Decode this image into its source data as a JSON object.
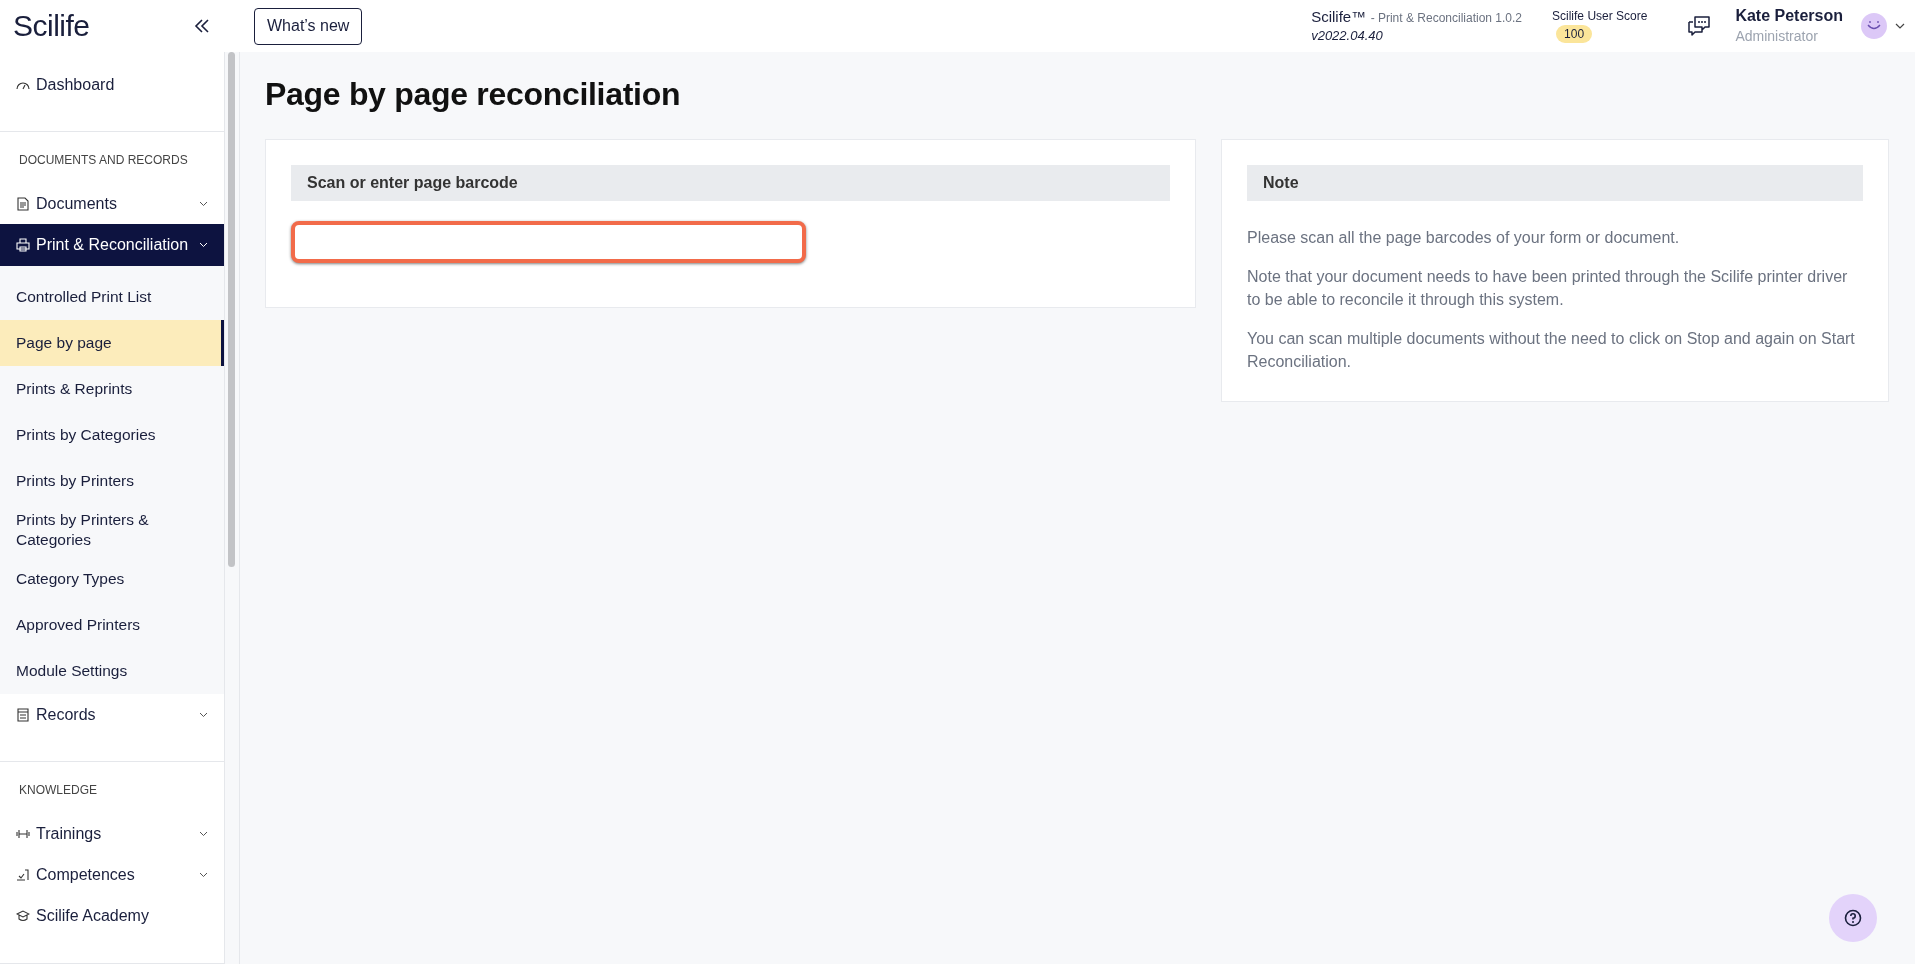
{
  "header": {
    "logo": "Scilife",
    "whats_new": "What’s new",
    "app_name": "Scilife™",
    "app_module": "- Print & Reconciliation 1.0.2",
    "app_version": "v2022.04.40",
    "score_label": "Scilife User Score",
    "score": "100",
    "user_name": "Kate Peterson",
    "user_role": "Administrator"
  },
  "sidebar": {
    "items": [
      {
        "kind": "link",
        "label": "Dashboard",
        "selected": false
      },
      {
        "kind": "section",
        "label": "DOCUMENTS AND RECORDS"
      },
      {
        "kind": "group",
        "label": "Documents",
        "selected": false
      },
      {
        "kind": "group",
        "label": "Print & Reconciliation",
        "selected": true,
        "expanded": true,
        "children": [
          {
            "label": "Controlled Print List",
            "selected": false
          },
          {
            "label": "Page by page",
            "selected": true
          },
          {
            "label": "Prints & Reprints",
            "selected": false
          },
          {
            "label": "Prints by Categories",
            "selected": false
          },
          {
            "label": "Prints by Printers",
            "selected": false
          },
          {
            "label": "Prints by Printers & Categories",
            "selected": false
          },
          {
            "label": "Category Types",
            "selected": false
          },
          {
            "label": "Approved Printers",
            "selected": false
          },
          {
            "label": "Module Settings",
            "selected": false
          }
        ]
      },
      {
        "kind": "group",
        "label": "Records",
        "selected": false
      },
      {
        "kind": "section",
        "label": "KNOWLEDGE"
      },
      {
        "kind": "group",
        "label": "Trainings",
        "selected": false
      },
      {
        "kind": "group",
        "label": "Competences",
        "selected": false
      },
      {
        "kind": "link",
        "label": "Scilife Academy",
        "selected": false
      }
    ]
  },
  "page": {
    "title": "Page by page reconciliation",
    "scan_card": {
      "heading": "Scan or enter page barcode"
    },
    "note_card": {
      "heading": "Note",
      "paragraphs": [
        "Please scan all the page barcodes of your form or document.",
        "Note that your document needs to have been printed through the Scilife printer driver to be able to reconcile it through this system.",
        "You can scan multiple documents without the need to click on Stop and again on Start Reconciliation."
      ]
    }
  }
}
